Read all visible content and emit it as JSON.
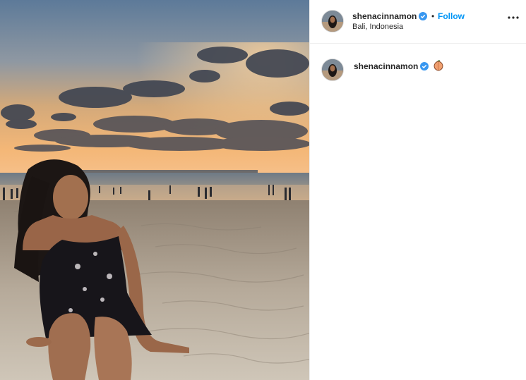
{
  "post": {
    "username": "shenacinnamon",
    "location": "Bali, Indonesia",
    "follow_label": "Follow",
    "separator": "•",
    "more_icon": "more-options-icon",
    "verified_icon": "verified-badge-icon"
  },
  "caption": {
    "username": "shenacinnamon",
    "emoji": "peach-emoji-icon"
  },
  "colors": {
    "accent": "#0095f6",
    "verified": "#3897f0",
    "text": "#262626",
    "border": "#efefef"
  }
}
